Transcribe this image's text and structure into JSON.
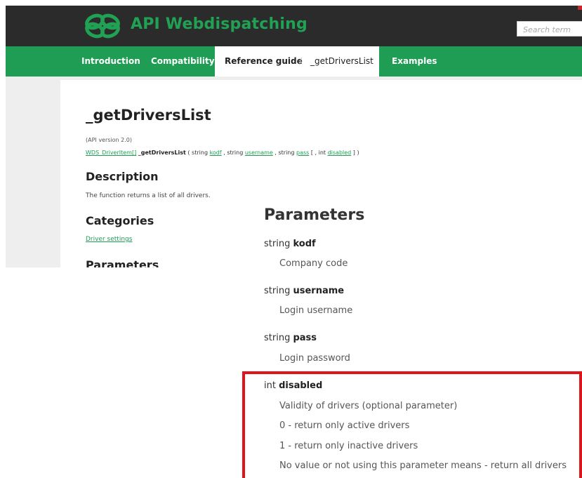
{
  "header": {
    "brand": "API Webdispatching",
    "search_placeholder": "Search term",
    "accent": "#21a154"
  },
  "nav": {
    "items": [
      "Introduction",
      "Compatibility",
      "Examples"
    ],
    "active": "Reference guide",
    "separator": "/",
    "current": "_getDriversList",
    "color": "#1f9d55"
  },
  "doc": {
    "title": "_getDriversList",
    "version": "(API version 2.0)",
    "signature": {
      "return_type": "WDS_DriverItem[]",
      "name": "_getDriversList",
      "open": " ( string ",
      "p1": "kodf",
      "s1": " , string ",
      "p2": "username",
      "s2": " , string ",
      "p3": "pass",
      "s3": " [ , int ",
      "p4": "disabled",
      "close": " ] )"
    },
    "description_heading": "Description",
    "description": "The function returns a list of all drivers.",
    "categories_heading": "Categories",
    "category_link": "Driver settings",
    "parameters_heading_small": "Parameters"
  },
  "params": {
    "heading": "Parameters",
    "items": [
      {
        "type": "string",
        "name": "kodf",
        "desc": [
          "Company code"
        ]
      },
      {
        "type": "string",
        "name": "username",
        "desc": [
          "Login username"
        ]
      },
      {
        "type": "string",
        "name": "pass",
        "desc": [
          "Login password"
        ]
      },
      {
        "type": "int",
        "name": "disabled",
        "desc": [
          "Validity of drivers (optional parameter)",
          "0 - return only active drivers",
          "1 - return only inactive drivers",
          "No value or not using this parameter means - return all drivers"
        ]
      }
    ],
    "highlight_color": "#e0151b"
  }
}
